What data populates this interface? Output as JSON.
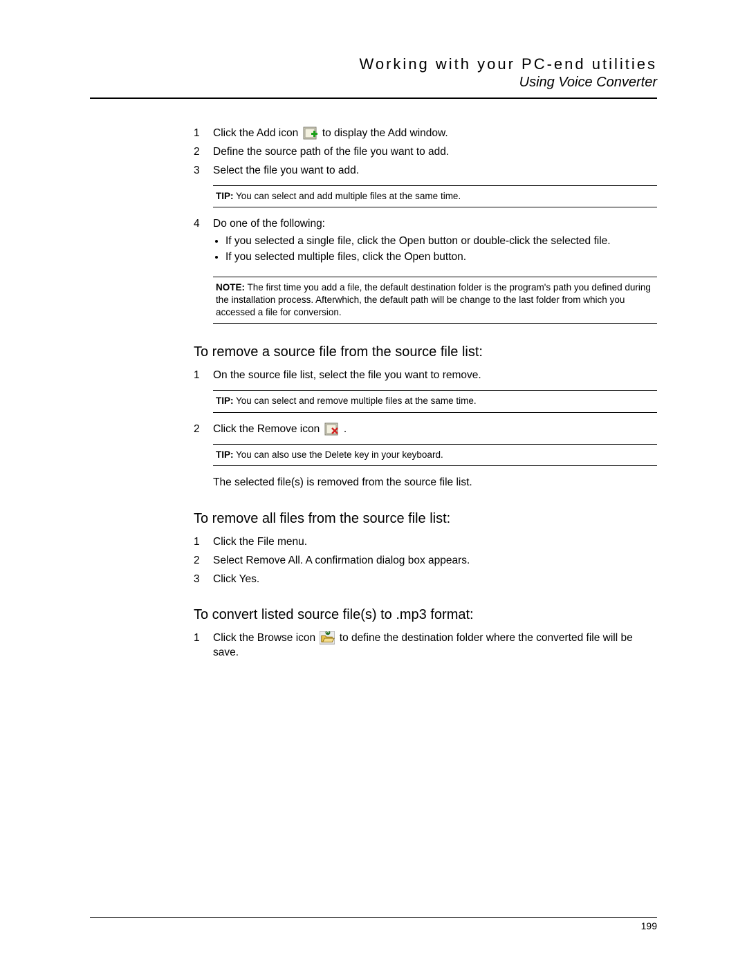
{
  "header": {
    "chapter": "Working with your PC-end utilities",
    "section": "Using Voice Converter"
  },
  "steps_a": {
    "s1": {
      "num": "1",
      "pre": "Click the Add icon ",
      "post": " to display the Add window."
    },
    "s2": {
      "num": "2",
      "text": "Define the source path of the file you want to add."
    },
    "s3": {
      "num": "3",
      "text": "Select the file you want to add."
    }
  },
  "tip1": {
    "label": "TIP:",
    "text": " You can select and add multiple files at the same time."
  },
  "step_a4": {
    "num": "4",
    "text": "Do one of the following:",
    "b1": "If you selected a single file, click the Open button or double-click the selected file.",
    "b2": "If you selected multiple files, click the Open button."
  },
  "note1": {
    "label": "NOTE:",
    "text": " The first time you add a file, the default destination folder is the program's path you defined during the installation process. Afterwhich, the default path will be change to the last folder from which you accessed a file for conversion."
  },
  "heading_remove_one": "To remove a source file from the source file list:",
  "steps_b": {
    "s1": {
      "num": "1",
      "text": "On the source file list, select the file you want to remove."
    }
  },
  "tip2": {
    "label": "TIP:",
    "text": " You can select and remove multiple files at the same time."
  },
  "step_b2": {
    "num": "2",
    "pre": "Click the Remove icon ",
    "post": "."
  },
  "tip3": {
    "label": "TIP:",
    "text": " You can also use the Delete key in your keyboard."
  },
  "result_b": "The selected file(s) is removed from the source file list.",
  "heading_remove_all": "To remove all files from the source file list:",
  "steps_c": {
    "s1": {
      "num": "1",
      "text": "Click the File menu."
    },
    "s2": {
      "num": "2",
      "text": "Select Remove All. A confirmation dialog box appears."
    },
    "s3": {
      "num": "3",
      "text": "Click Yes."
    }
  },
  "heading_convert": "To convert listed source file(s) to .mp3 format:",
  "step_d1": {
    "num": "1",
    "pre": "Click the Browse icon ",
    "post": " to define the destination folder where the converted file will be save."
  },
  "page_number": "199"
}
